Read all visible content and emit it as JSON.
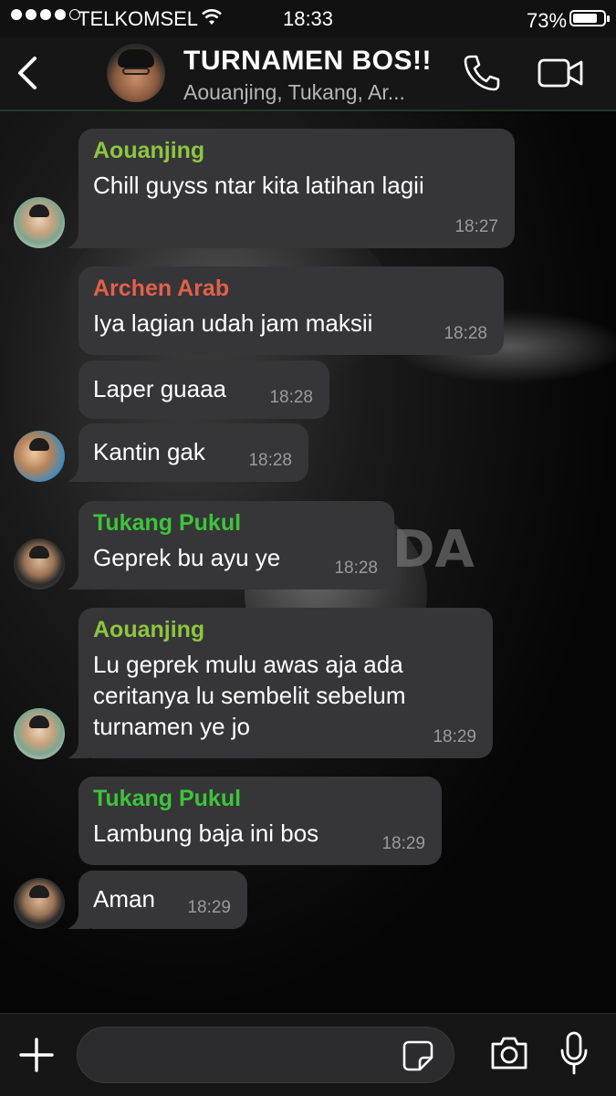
{
  "status_bar": {
    "carrier": "TELKOMSEL",
    "time": "18:33",
    "battery_pct": "73%",
    "signal_bars": 4,
    "signal_max": 5
  },
  "header": {
    "title": "TURNAMEN BOS!!",
    "members": "Aouanjing, Tukang, Ar...",
    "icons": [
      "back-icon",
      "phone-icon",
      "video-call-icon"
    ]
  },
  "colors": {
    "sender_green": "#8dc63f",
    "sender_red": "#e2604a",
    "sender_bright_green": "#3ec43b",
    "bubble": "#363638"
  },
  "messages": [
    {
      "sender": "Aouanjing",
      "text": "Chill guyss ntar kita latihan lagii",
      "time": "18:27"
    },
    {
      "sender": "Archen Arab",
      "text": "Iya lagian udah jam maksii",
      "time": "18:28"
    },
    {
      "sender": "",
      "text": "Laper guaaa",
      "time": "18:28"
    },
    {
      "sender": "",
      "text": "Kantin gak",
      "time": "18:28"
    },
    {
      "sender": "Tukang Pukul",
      "text": "Geprek bu ayu ye",
      "time": "18:28"
    },
    {
      "sender": "Aouanjing",
      "text": "Lu geprek mulu awas aja ada ceritanya lu sembelit sebelum turnamen ye jo",
      "time": "18:29"
    },
    {
      "sender": "Tukang Pukul",
      "text": "Lambung baja ini bos",
      "time": "18:29"
    },
    {
      "sender": "",
      "text": "Aman",
      "time": "18:29"
    }
  ],
  "background": {
    "sign_text": "DA"
  },
  "composer": {
    "placeholder": "",
    "icons": [
      "plus-icon",
      "sticker-icon",
      "camera-icon",
      "microphone-icon"
    ]
  }
}
